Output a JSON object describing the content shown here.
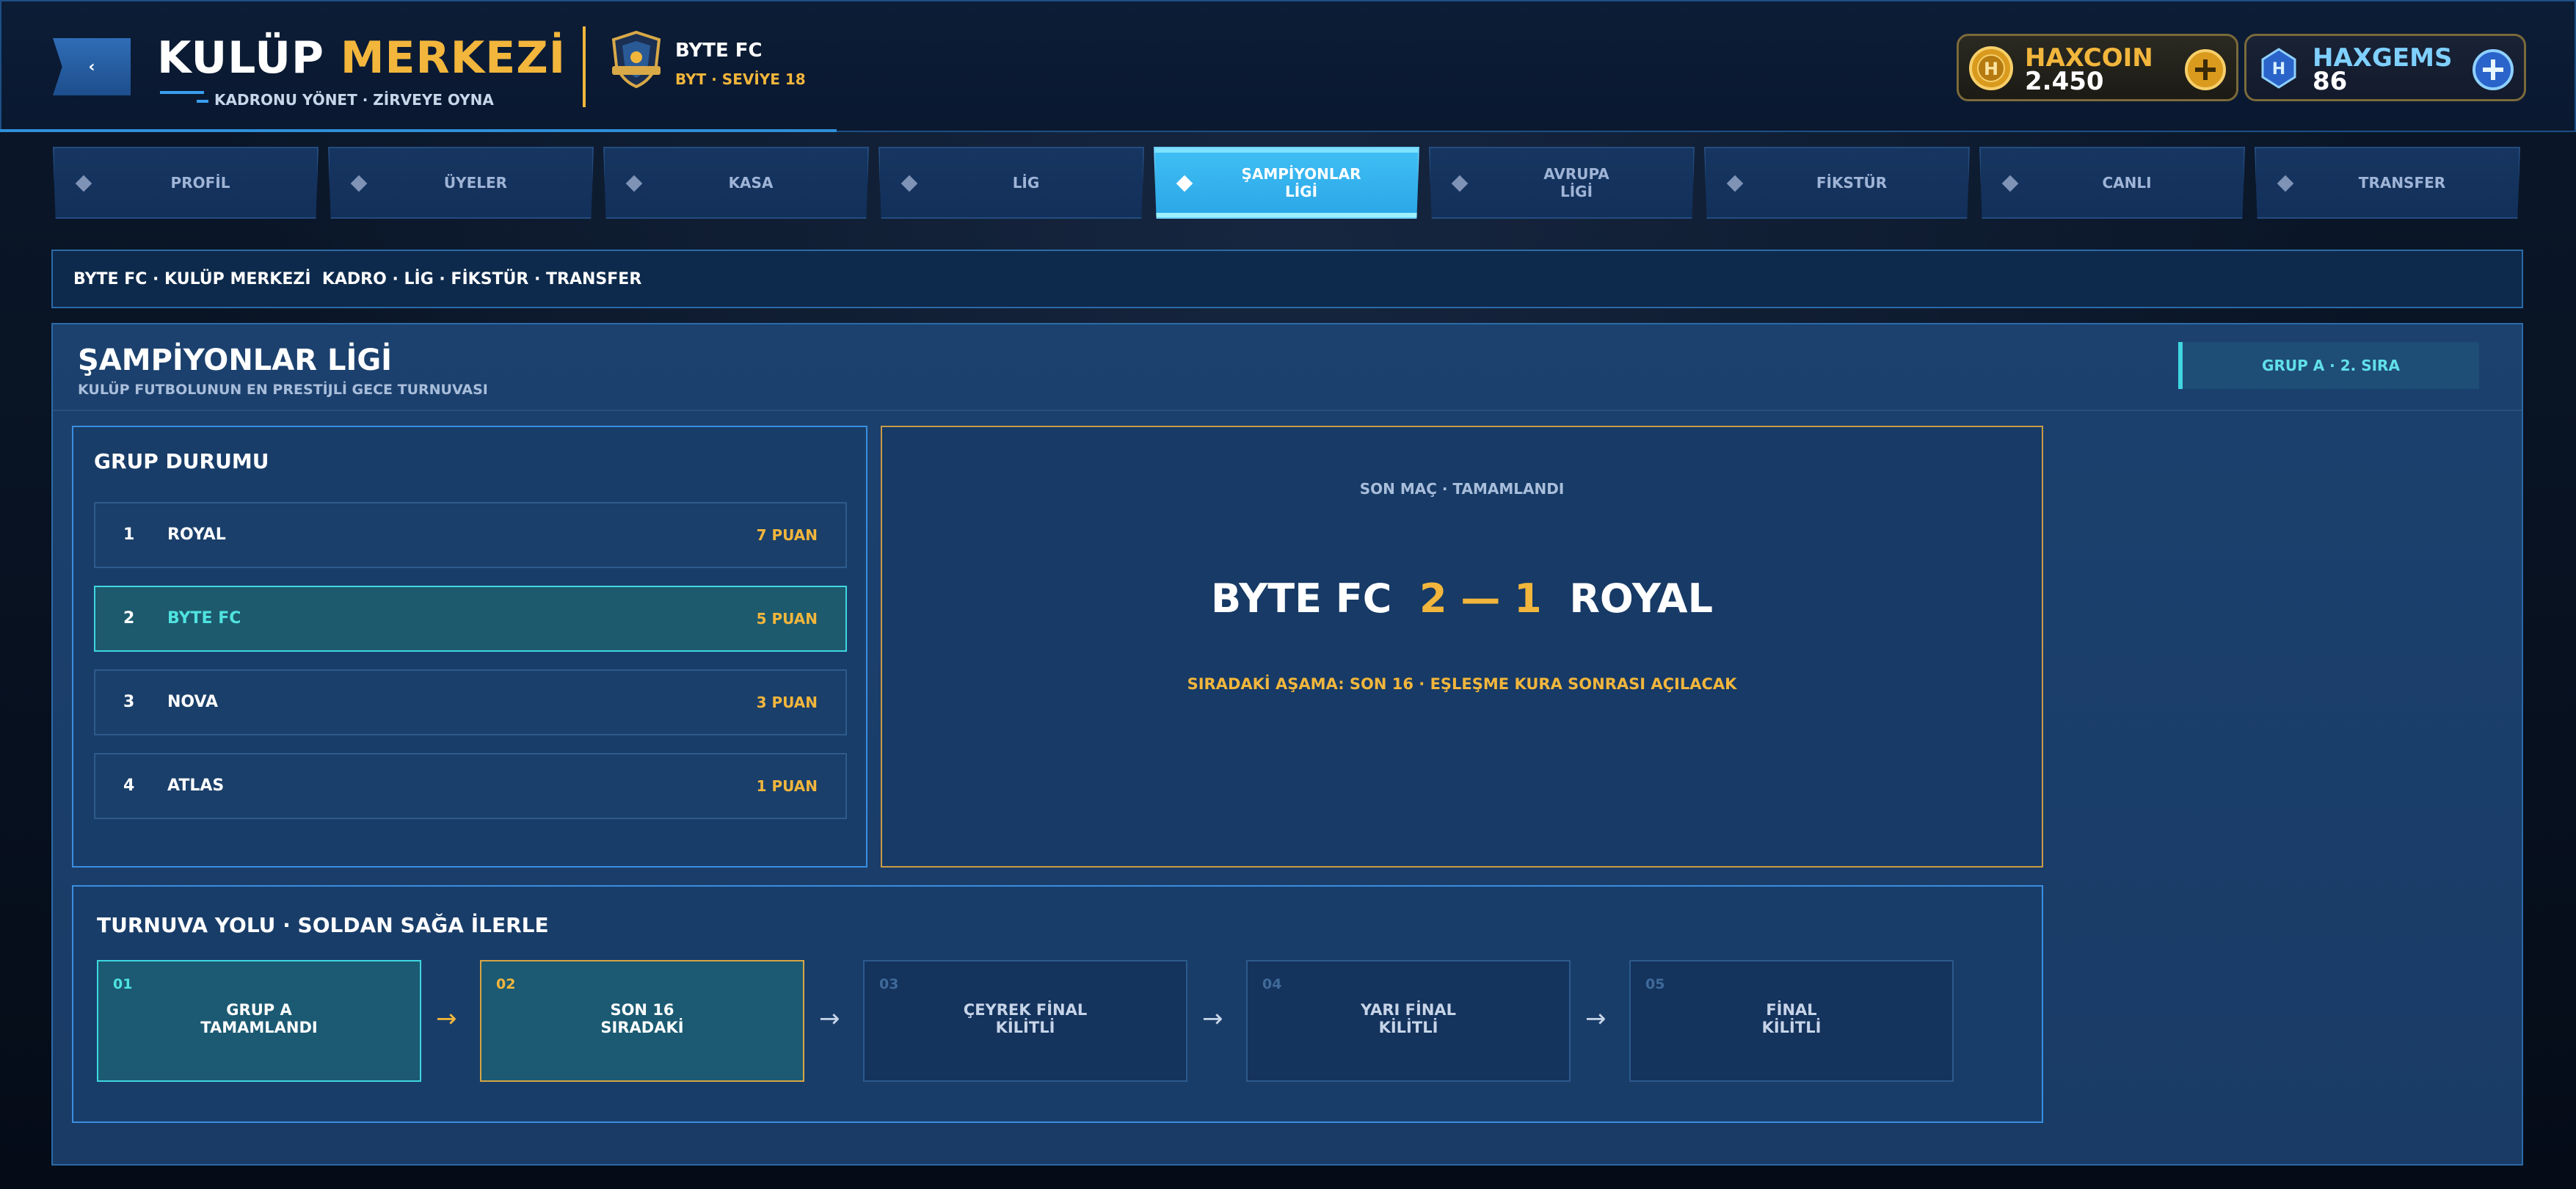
{
  "header": {
    "title_part1": "KULÜP",
    "title_part2": "MERKEZİ",
    "subtitle": "KADRONU YÖNET · ZİRVEYE OYNA",
    "club_name": "BYTE FC",
    "club_meta": "BYT · SEVİYE 18",
    "currencies": [
      {
        "name": "HAXCOIN",
        "value": "2.450"
      },
      {
        "name": "HAXGEMS",
        "value": "86"
      }
    ]
  },
  "nav": {
    "tabs": [
      {
        "label": "PROFİL"
      },
      {
        "label": "ÜYELER"
      },
      {
        "label": "KASA"
      },
      {
        "label": "LİG"
      },
      {
        "label": "ŞAMPİYONLAR\nLİGİ",
        "active": true
      },
      {
        "label": "AVRUPA\nLİGİ"
      },
      {
        "label": "FİKSTÜR"
      },
      {
        "label": "CANLI"
      },
      {
        "label": "TRANSFER"
      }
    ]
  },
  "breadcrumb": "BYTE FC · KULÜP MERKEZİ  KADRO · LİG · FİKSTÜR · TRANSFER",
  "page": {
    "title": "ŞAMPİYONLAR LİGİ",
    "subtitle": "KULÜP FUTBOLUNUN EN PRESTİJLİ GECE TURNUVASI",
    "group_badge": "GRUP A · 2. SIRA"
  },
  "standings": {
    "title": "GRUP DURUMU",
    "rows": [
      {
        "rank": "1",
        "team": "ROYAL",
        "points": "7 PUAN"
      },
      {
        "rank": "2",
        "team": "BYTE FC",
        "points": "5 PUAN",
        "highlight": true
      },
      {
        "rank": "3",
        "team": "NOVA",
        "points": "3 PUAN"
      },
      {
        "rank": "4",
        "team": "ATLAS",
        "points": "1 PUAN"
      }
    ]
  },
  "last_match": {
    "status": "SON MAÇ · TAMAMLANDI",
    "home": "BYTE FC",
    "score": "2 — 1",
    "away": "ROYAL",
    "next_stage": "SIRADAKİ AŞAMA: SON 16 · EŞLEŞME KURA SONRASI AÇILACAK"
  },
  "tournament_path": {
    "title": "TURNUVA YOLU · SOLDAN SAĞA İLERLE",
    "stages": [
      {
        "num": "01",
        "label": "GRUP A\nTAMAMLANDI",
        "state": "done"
      },
      {
        "num": "02",
        "label": "SON 16\nSIRADAKİ",
        "state": "next"
      },
      {
        "num": "03",
        "label": "ÇEYREK FİNAL\nKİLİTLİ",
        "state": "locked"
      },
      {
        "num": "04",
        "label": "YARI FİNAL\nKİLİTLİ",
        "state": "locked"
      },
      {
        "num": "05",
        "label": "FİNAL\nKİLİTLİ",
        "state": "locked"
      }
    ],
    "arrow": "→"
  },
  "colors": {
    "accent_gold": "#f2b63c",
    "accent_cyan": "#3fd6e0",
    "active_tab": "#2aa6e6"
  },
  "icons": [
    "back-chevron-icon",
    "club-crest-icon",
    "haxcoin-icon",
    "haxgems-icon",
    "plus-icon",
    "diamond-icon",
    "arrow-right-icon"
  ]
}
